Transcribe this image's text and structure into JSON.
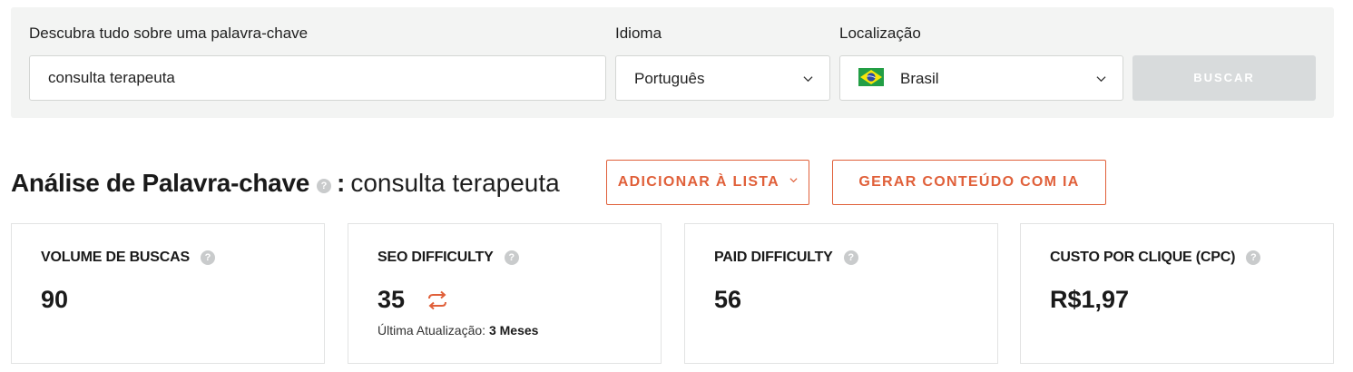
{
  "search": {
    "keyword_label": "Descubra tudo sobre uma palavra-chave",
    "keyword_value": "consulta terapeuta",
    "language_label": "Idioma",
    "language_value": "Português",
    "location_label": "Localização",
    "location_value": "Brasil",
    "location_flag": "brazil-flag",
    "submit_label": "BUSCAR"
  },
  "analysis": {
    "title": "Análise de Palavra-chave",
    "colon": ":",
    "keyword": "consulta terapeuta",
    "help_glyph": "?",
    "add_to_list_label": "ADICIONAR À LISTA",
    "generate_ai_label": "GERAR CONTEÚDO COM IA"
  },
  "metrics": [
    {
      "label": "VOLUME DE BUSCAS",
      "value": "90"
    },
    {
      "label": "SEO DIFFICULTY",
      "value": "35",
      "updated_prefix": "Última Atualização:",
      "updated_value": "3 Meses"
    },
    {
      "label": "PAID DIFFICULTY",
      "value": "56"
    },
    {
      "label": "CUSTO POR CLIQUE (CPC)",
      "value": "R$1,97"
    }
  ],
  "colors": {
    "accent": "#e0603a",
    "panel_bg": "#f3f4f3",
    "disabled_button": "#d8dbdc",
    "help_icon": "#c9cbcc"
  }
}
